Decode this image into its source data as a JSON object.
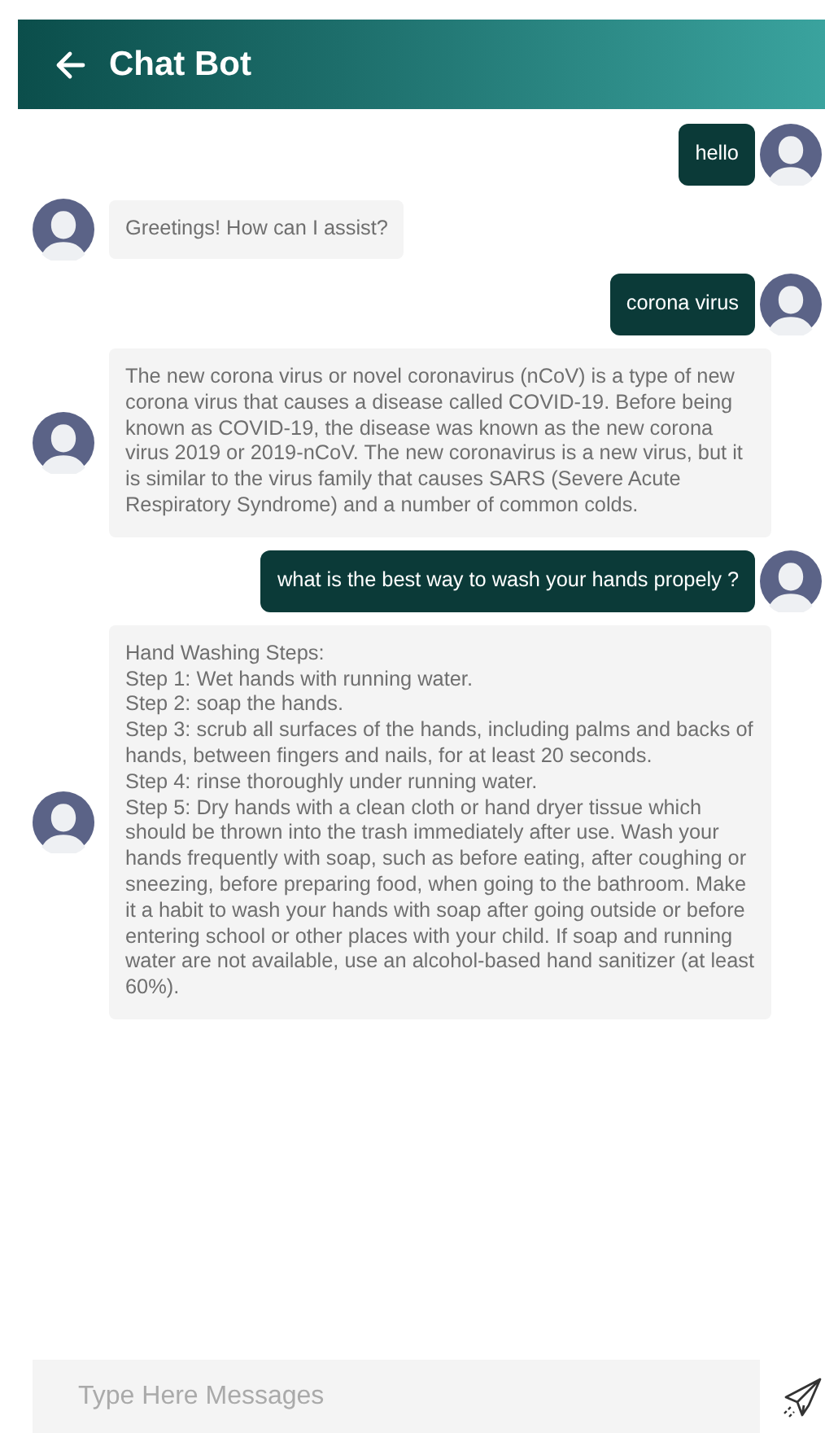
{
  "header": {
    "title": "Chat Bot"
  },
  "messages": [
    {
      "kind": "user",
      "text": "hello"
    },
    {
      "kind": "bot",
      "text": "Greetings! How can I assist?"
    },
    {
      "kind": "user",
      "text": "corona virus"
    },
    {
      "kind": "bot",
      "text": "The new corona virus or novel coronavirus (nCoV) is a type of new corona virus that causes a disease called COVID-19. Before being known as COVID-19, the disease was known as the new corona virus 2019 or 2019-nCoV. The new coronavirus is a new virus, but it is similar to the virus family that causes SARS (Severe Acute Respiratory Syndrome) and a number of common colds."
    },
    {
      "kind": "user",
      "text": "what is the best way to wash your hands propely ?"
    },
    {
      "kind": "bot",
      "text": "Hand Washing Steps:\nStep 1: Wet hands with running water.\nStep 2: soap the hands.\nStep 3: scrub all surfaces of the hands, including palms and backs of hands, between fingers and nails, for at least 20 seconds.\nStep 4: rinse thoroughly under running water.\nStep 5: Dry hands with a clean cloth or hand dryer tissue which should be thrown into the trash immediately after use. Wash your hands frequently with soap, such as before eating, after coughing or sneezing, before preparing food, when going to the bathroom. Make it a habit to wash your hands with soap after going outside or before entering school or other places with your child. If soap and running water are not available, use an alcohol-based hand sanitizer (at least 60%)."
    }
  ],
  "composer": {
    "placeholder": "Type Here Messages"
  }
}
